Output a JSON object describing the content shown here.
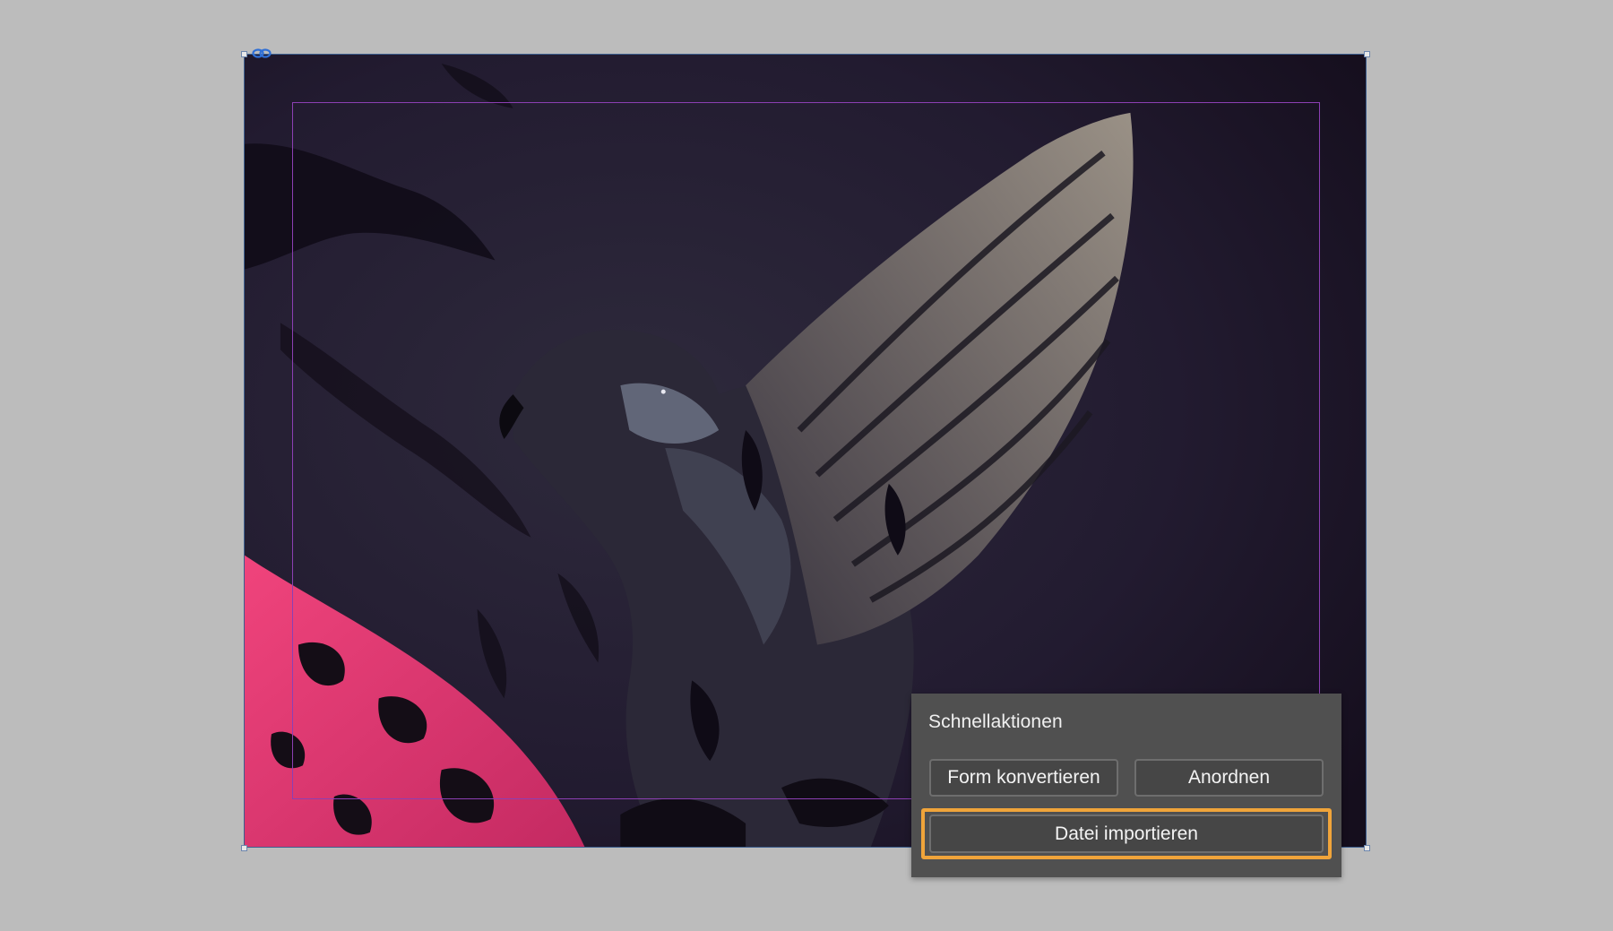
{
  "quick_actions": {
    "title": "Schnellaktionen",
    "buttons": {
      "convert_shape": "Form konvertieren",
      "arrange": "Anordnen",
      "import_file": "Datei importieren"
    },
    "highlight_color": "#f0a43a"
  },
  "canvas": {
    "background_color": "#bcbcbc",
    "frame_border_color": "#3d5f8f",
    "margin_guide_color": "#8c3fb3",
    "artwork_colors": [
      "#1a1226",
      "#2a2438",
      "#e0386e",
      "#8a8378"
    ]
  },
  "icons": {
    "frame_link": "link-icon"
  }
}
